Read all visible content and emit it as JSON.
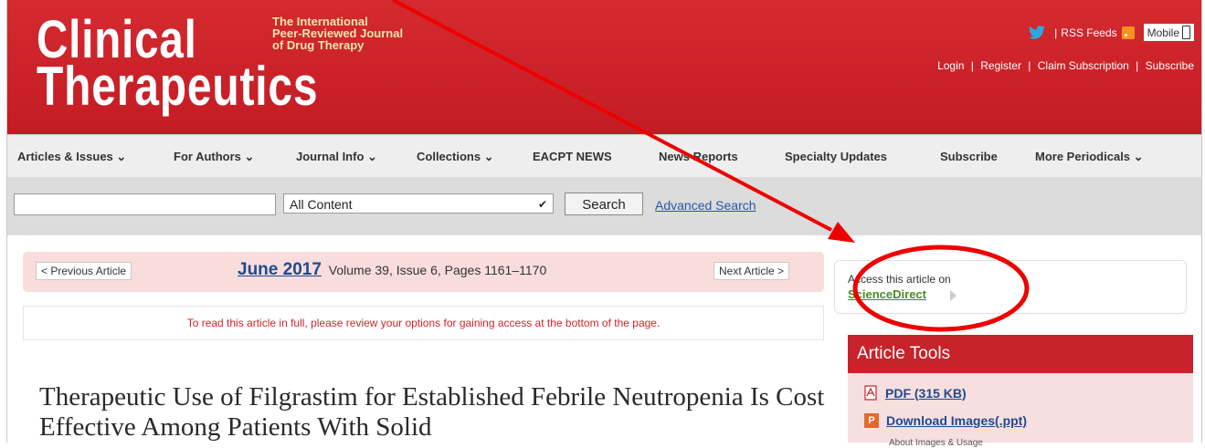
{
  "header": {
    "logo_line1": "Clinical",
    "logo_line2": "Therapeutics",
    "tagline": [
      "The International",
      "Peer-Reviewed Journal",
      "of Drug Therapy"
    ],
    "rss_label": "RSS Feeds",
    "mobile_label": "Mobile",
    "auth_links": [
      "Login",
      "Register",
      "Claim Subscription",
      "Subscribe"
    ]
  },
  "nav": {
    "items": [
      "Articles & Issues ⌄",
      "For Authors ⌄",
      "Journal Info ⌄",
      "Collections ⌄",
      "EACPT NEWS",
      "News Reports",
      "Specialty Updates",
      "Subscribe",
      "More Periodicals ⌄"
    ]
  },
  "search": {
    "input_value": "",
    "scope_value": "All Content",
    "button_label": "Search",
    "advanced_label": "Advanced Search"
  },
  "article_nav": {
    "prev_label": "< Previous Article",
    "next_label": "Next Article >",
    "issue_date": "June 2017",
    "issue_detail": "Volume 39, Issue 6, Pages 1161–1170"
  },
  "notice": "To read this article in full, please review your options for gaining access at the bottom of the page.",
  "article": {
    "title": "Therapeutic Use of Filgrastim for Established Febrile Neutropenia Is Cost Effective Among Patients With Solid"
  },
  "access": {
    "label": "Access this article on",
    "link": "ScienceDirect"
  },
  "tools": {
    "title": "Article Tools",
    "items": [
      {
        "label": "PDF (315 KB)",
        "icon": "pdf-icon"
      },
      {
        "label": "Download Images(.ppt)",
        "icon": "ppt-icon"
      }
    ],
    "sub_label": "About Images & Usage"
  },
  "colors": {
    "brand_red": "#cb2027",
    "tagline_yellow": "#f3e6ad",
    "link_blue": "#1f4a8f",
    "sciencedirect_green": "#4a8a1f",
    "annotation_red": "#ee0000"
  }
}
